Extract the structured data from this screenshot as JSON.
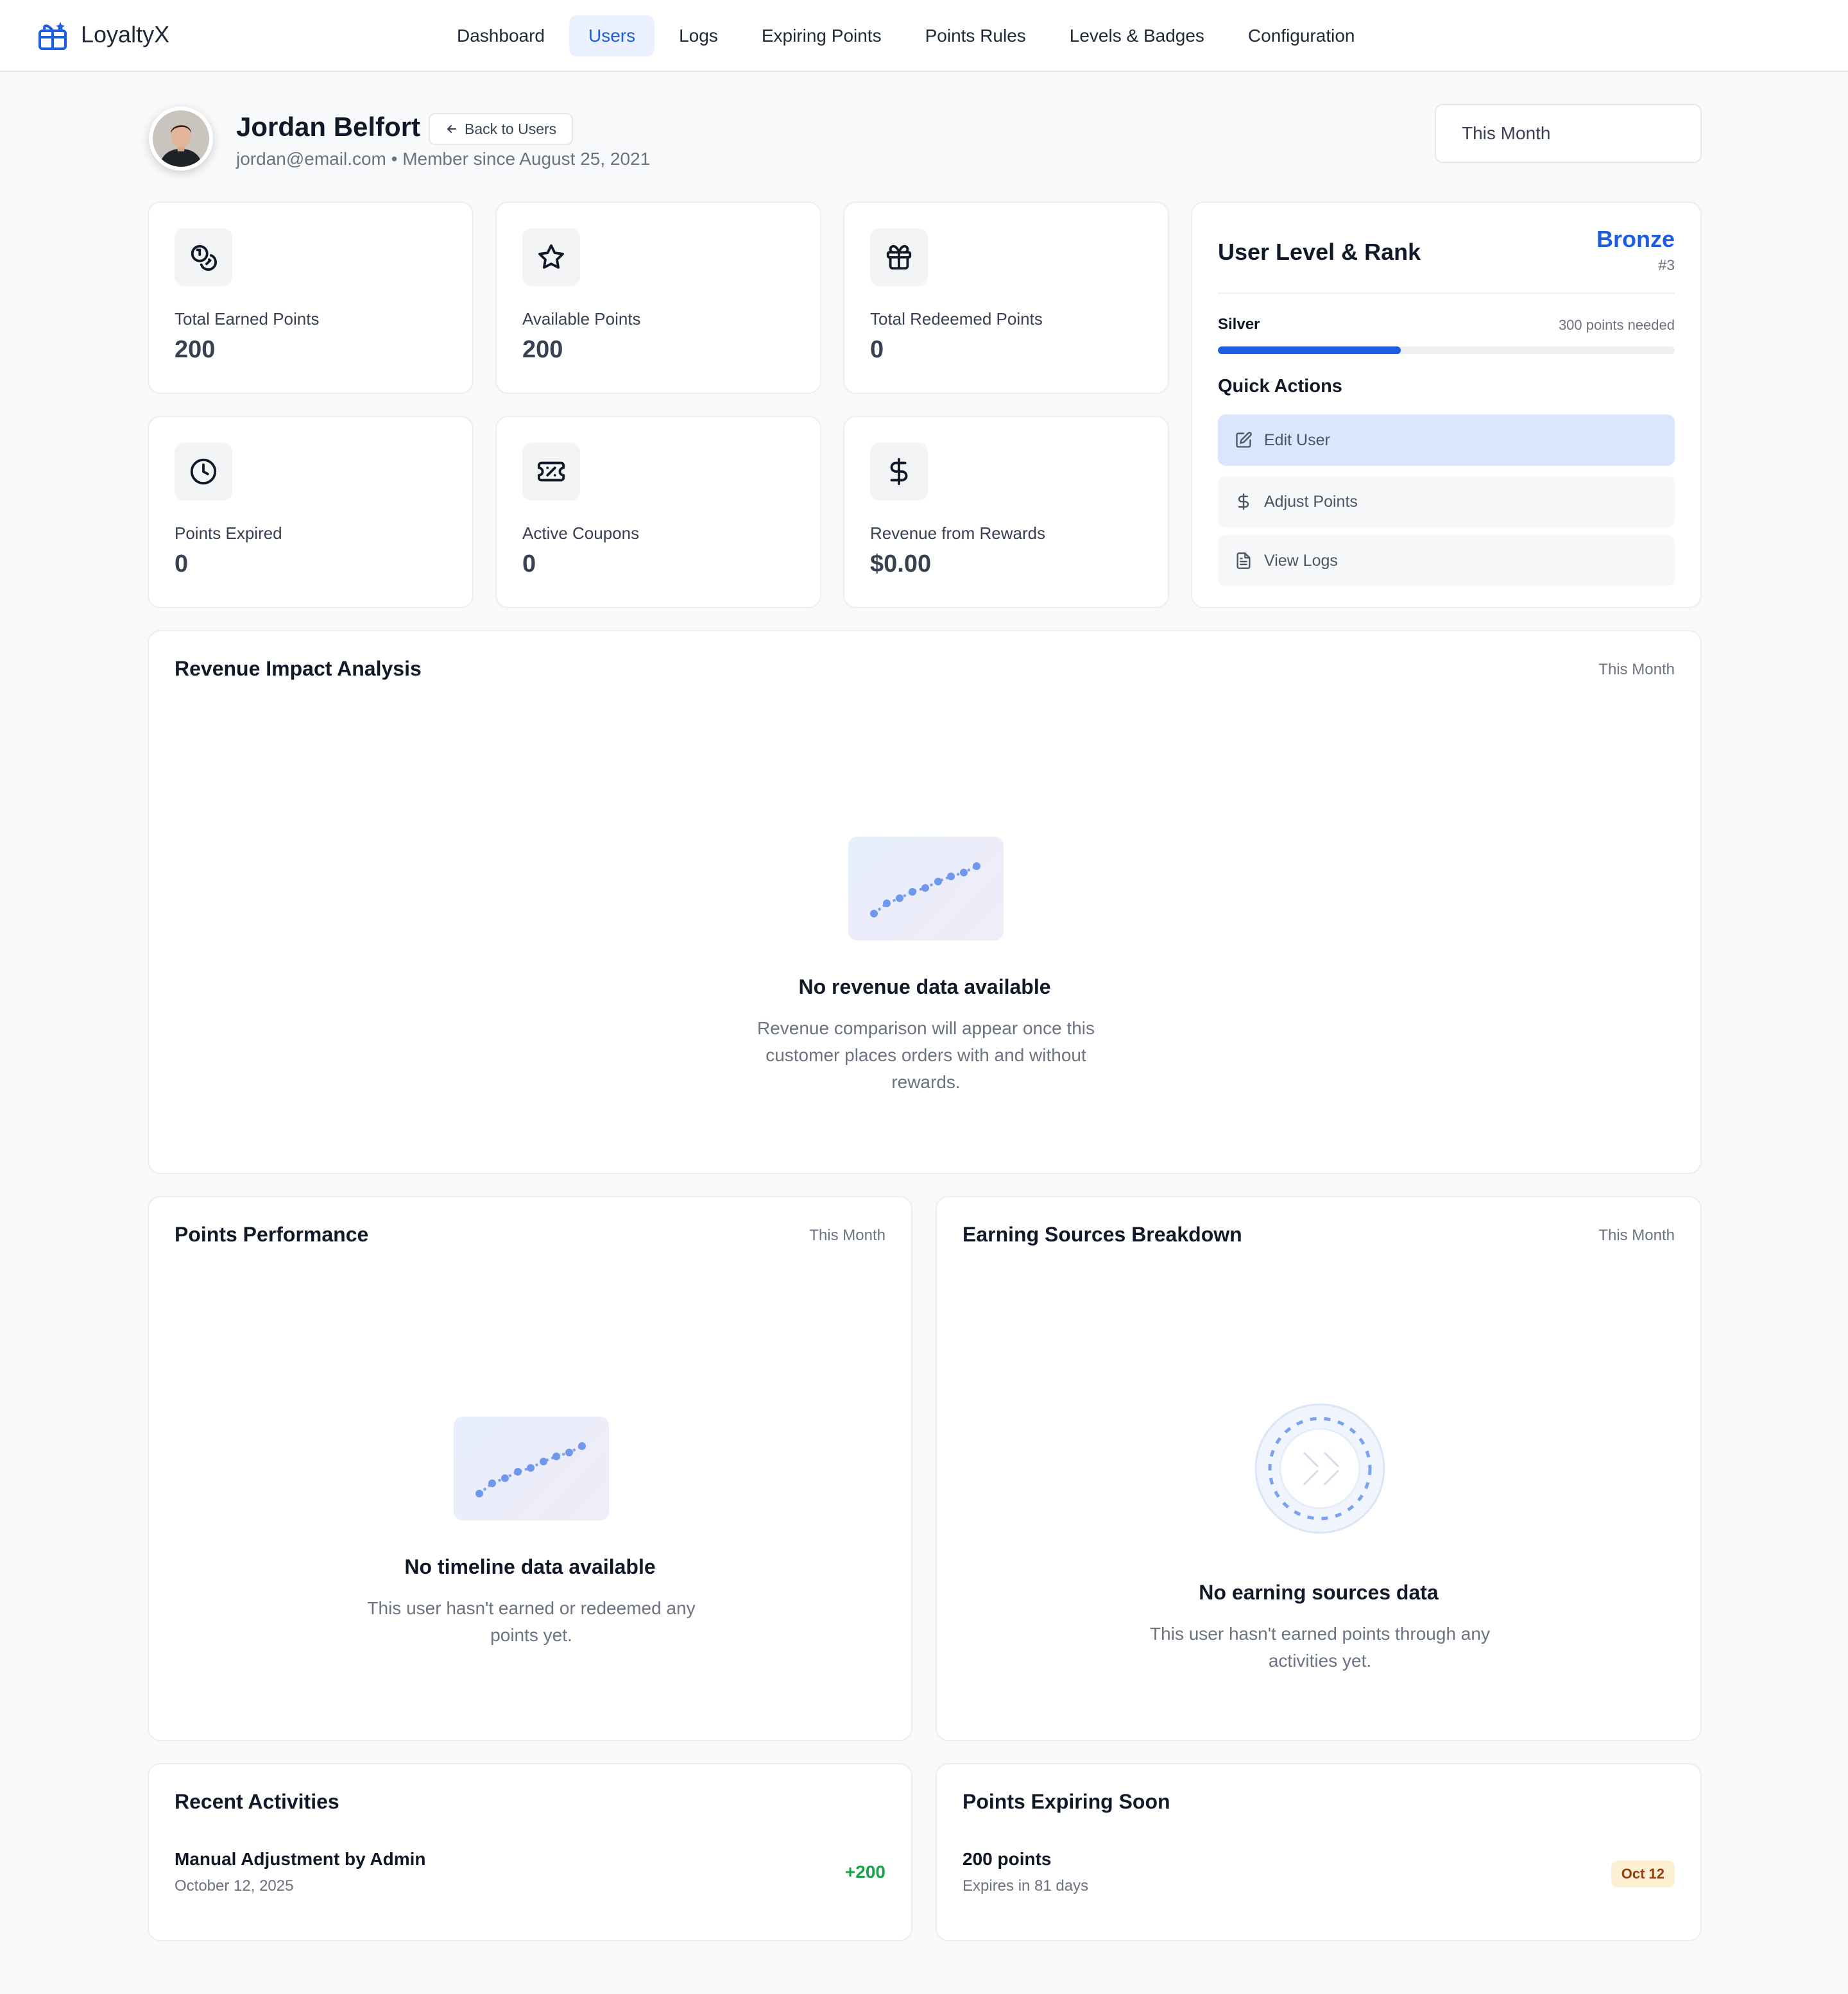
{
  "app": {
    "name": "LoyaltyX"
  },
  "nav": {
    "items": [
      {
        "label": "Dashboard"
      },
      {
        "label": "Users",
        "active": true
      },
      {
        "label": "Logs"
      },
      {
        "label": "Expiring Points"
      },
      {
        "label": "Points Rules"
      },
      {
        "label": "Levels & Badges"
      },
      {
        "label": "Configuration"
      }
    ]
  },
  "user": {
    "name": "Jordan Belfort",
    "back_label": "Back to Users",
    "meta": "jordan@email.com • Member since August 25, 2021"
  },
  "period_select": {
    "value": "This Month"
  },
  "stats": [
    {
      "icon": "coins-icon",
      "label": "Total Earned Points",
      "value": "200"
    },
    {
      "icon": "star-icon",
      "label": "Available Points",
      "value": "200"
    },
    {
      "icon": "gift-icon",
      "label": "Total Redeemed Points",
      "value": "0"
    },
    {
      "icon": "clock-icon",
      "label": "Points Expired",
      "value": "0"
    },
    {
      "icon": "ticket-icon",
      "label": "Active Coupons",
      "value": "0"
    },
    {
      "icon": "dollar-icon",
      "label": "Revenue from Rewards",
      "value": "$0.00"
    }
  ],
  "level": {
    "title": "User Level & Rank",
    "current": "Bronze",
    "rank": "#3",
    "next_level": "Silver",
    "points_needed": "300 points needed",
    "progress_fraction": 0.4,
    "accent_color": "#1d5ee0"
  },
  "quick_actions": {
    "title": "Quick Actions",
    "items": [
      {
        "label": "Edit User",
        "icon": "edit-icon"
      },
      {
        "label": "Adjust Points",
        "icon": "dollar-icon"
      },
      {
        "label": "View Logs",
        "icon": "document-icon"
      }
    ]
  },
  "revenue": {
    "title": "Revenue Impact Analysis",
    "period": "This Month",
    "empty_title": "No revenue data available",
    "empty_desc": "Revenue comparison will appear once this customer places orders with and without rewards."
  },
  "performance": {
    "title": "Points Performance",
    "period": "This Month",
    "empty_title": "No timeline data available",
    "empty_desc": "This user hasn't earned or redeemed any points yet."
  },
  "sources": {
    "title": "Earning Sources Breakdown",
    "period": "This Month",
    "empty_title": "No earning sources data",
    "empty_desc": "This user hasn't earned points through any activities yet."
  },
  "activities": {
    "title": "Recent Activities",
    "items": [
      {
        "title": "Manual Adjustment by Admin",
        "date": "October 12, 2025",
        "delta": "+200"
      }
    ]
  },
  "expiring": {
    "title": "Points Expiring Soon",
    "items": [
      {
        "title": "200 points",
        "subtitle": "Expires in 81 days",
        "badge": "Oct 12"
      }
    ]
  },
  "colors": {
    "positive": "#16a34a",
    "badge_bg": "#fdefd2"
  }
}
